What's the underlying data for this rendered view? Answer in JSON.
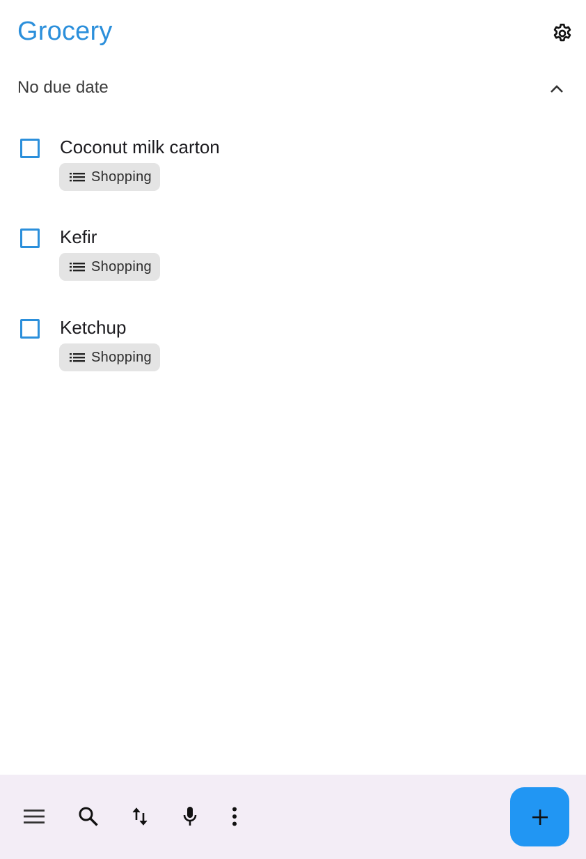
{
  "header": {
    "title": "Grocery",
    "settings_icon": "gear-icon"
  },
  "group": {
    "label": "No due date",
    "toggle_icon": "chevron-up-icon"
  },
  "tasks": [
    {
      "title": "Coconut milk carton",
      "checked": false,
      "list_chip": {
        "icon": "list-icon",
        "label": "Shopping"
      }
    },
    {
      "title": "Kefir",
      "checked": false,
      "list_chip": {
        "icon": "list-icon",
        "label": "Shopping"
      }
    },
    {
      "title": "Ketchup",
      "checked": false,
      "list_chip": {
        "icon": "list-icon",
        "label": "Shopping"
      }
    }
  ],
  "bottom_bar": {
    "buttons": [
      {
        "icon": "menu-icon"
      },
      {
        "icon": "search-icon"
      },
      {
        "icon": "sort-icon"
      },
      {
        "icon": "microphone-icon"
      },
      {
        "icon": "more-vert-icon"
      }
    ],
    "fab": {
      "icon": "add-icon"
    }
  },
  "colors": {
    "accent": "#2b8fdb",
    "fab": "#2196f3",
    "bottom_bar_bg": "#f3edf6",
    "chip_bg": "#e4e4e4"
  }
}
